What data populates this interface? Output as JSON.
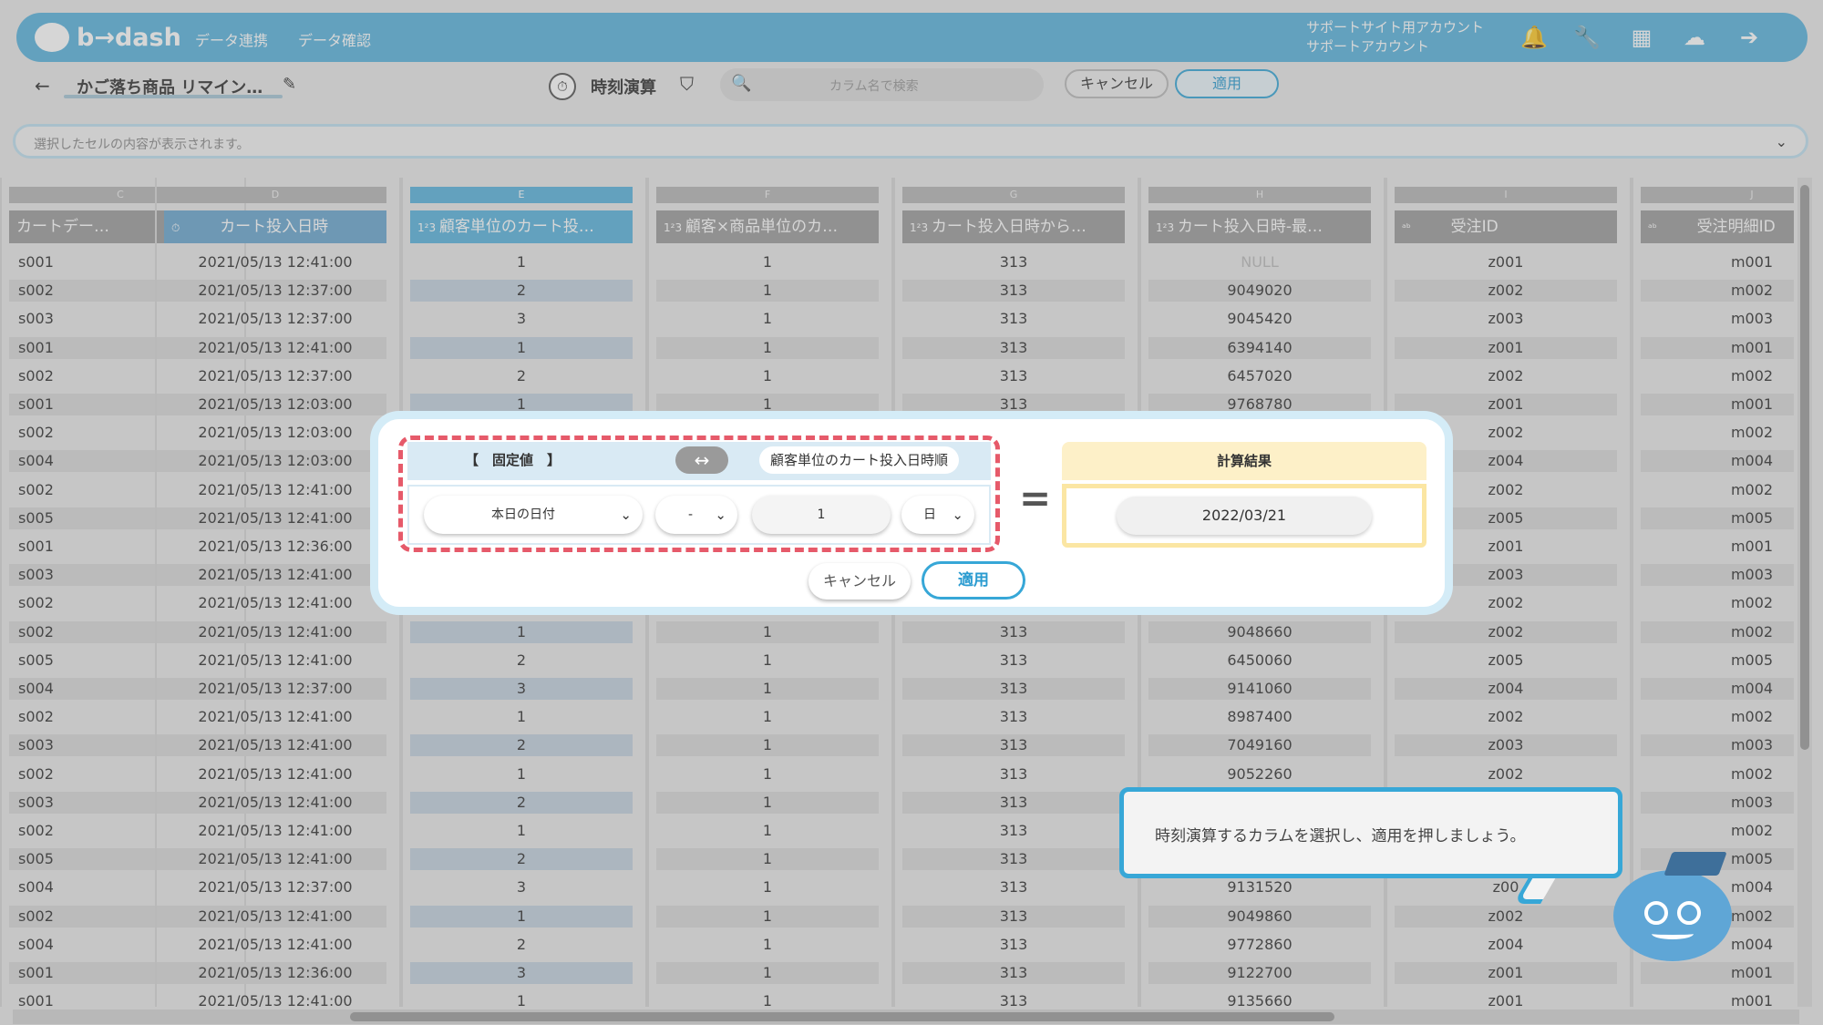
{
  "app": {
    "logo": "b→dash",
    "nav": [
      "データ連携",
      "データ確認"
    ],
    "account_line1": "サポートサイト用アカウント",
    "account_line2": "サポートアカウント"
  },
  "toolbar": {
    "title": "かご落ち商品 リマイン…",
    "function_label": "時刻演算",
    "search_placeholder": "カラム名で検索",
    "cancel": "キャンセル",
    "apply": "適用"
  },
  "cellbar": {
    "placeholder": "選択したセルの内容が表示されます。"
  },
  "columns": [
    {
      "letter": "C",
      "header": "カートデー…",
      "icon": "",
      "kind": "text"
    },
    {
      "letter": "D",
      "header": "カート投入日時",
      "icon": "clock-icon",
      "kind": "date"
    },
    {
      "letter": "E",
      "header": "顧客単位のカート投…",
      "icon": "123-icon",
      "kind": "num",
      "selected": true
    },
    {
      "letter": "F",
      "header": "顧客×商品単位のカ…",
      "icon": "123-icon",
      "kind": "num"
    },
    {
      "letter": "G",
      "header": "カート投入日時から…",
      "icon": "123-icon",
      "kind": "num"
    },
    {
      "letter": "H",
      "header": "カート投入日時-最…",
      "icon": "123-icon",
      "kind": "num"
    },
    {
      "letter": "I",
      "header": "受注ID",
      "icon": "abc-icon",
      "kind": "text"
    },
    {
      "letter": "J",
      "header": "受注明細ID",
      "icon": "abc-icon",
      "kind": "text"
    }
  ],
  "rows": [
    [
      "s001",
      "2021/05/13 12:41:00",
      "1",
      "1",
      "313",
      "NULL",
      "z001",
      "m001"
    ],
    [
      "s002",
      "2021/05/13 12:37:00",
      "2",
      "1",
      "313",
      "9049020",
      "z002",
      "m002"
    ],
    [
      "s003",
      "2021/05/13 12:37:00",
      "3",
      "1",
      "313",
      "9045420",
      "z003",
      "m003"
    ],
    [
      "s001",
      "2021/05/13 12:41:00",
      "1",
      "1",
      "313",
      "6394140",
      "z001",
      "m001"
    ],
    [
      "s002",
      "2021/05/13 12:37:00",
      "2",
      "1",
      "313",
      "6457020",
      "z002",
      "m002"
    ],
    [
      "s001",
      "2021/05/13 12:03:00",
      "1",
      "1",
      "313",
      "9768780",
      "z001",
      "m001"
    ],
    [
      "s002",
      "2021/05/13 12:03:00",
      "",
      "",
      "",
      "",
      "z002",
      "m002"
    ],
    [
      "s004",
      "2021/05/13 12:03:00",
      "",
      "",
      "",
      "",
      "z004",
      "m004"
    ],
    [
      "s002",
      "2021/05/13 12:41:00",
      "",
      "",
      "",
      "",
      "z002",
      "m002"
    ],
    [
      "s005",
      "2021/05/13 12:41:00",
      "",
      "",
      "",
      "",
      "z005",
      "m005"
    ],
    [
      "s001",
      "2021/05/13 12:36:00",
      "",
      "",
      "",
      "",
      "z001",
      "m001"
    ],
    [
      "s003",
      "2021/05/13 12:41:00",
      "",
      "",
      "",
      "",
      "z003",
      "m003"
    ],
    [
      "s002",
      "2021/05/13 12:41:00",
      "",
      "",
      "",
      "",
      "z002",
      "m002"
    ],
    [
      "s002",
      "2021/05/13 12:41:00",
      "1",
      "1",
      "313",
      "9048660",
      "z002",
      "m002"
    ],
    [
      "s005",
      "2021/05/13 12:41:00",
      "2",
      "1",
      "313",
      "6450060",
      "z005",
      "m005"
    ],
    [
      "s004",
      "2021/05/13 12:37:00",
      "3",
      "1",
      "313",
      "9141060",
      "z004",
      "m004"
    ],
    [
      "s002",
      "2021/05/13 12:41:00",
      "1",
      "1",
      "313",
      "8987400",
      "z002",
      "m002"
    ],
    [
      "s003",
      "2021/05/13 12:41:00",
      "2",
      "1",
      "313",
      "7049160",
      "z003",
      "m003"
    ],
    [
      "s002",
      "2021/05/13 12:41:00",
      "1",
      "1",
      "313",
      "9052260",
      "z002",
      "m002"
    ],
    [
      "s003",
      "2021/05/13 12:41:00",
      "2",
      "1",
      "313",
      "",
      "",
      "m003"
    ],
    [
      "s002",
      "2021/05/13 12:41:00",
      "1",
      "1",
      "313",
      "",
      "",
      "m002"
    ],
    [
      "s005",
      "2021/05/13 12:41:00",
      "2",
      "1",
      "313",
      "",
      "",
      "m005"
    ],
    [
      "s004",
      "2021/05/13 12:37:00",
      "3",
      "1",
      "313",
      "9131520",
      "z00",
      "m004"
    ],
    [
      "s002",
      "2021/05/13 12:41:00",
      "1",
      "1",
      "313",
      "9049860",
      "z002",
      "m002"
    ],
    [
      "s004",
      "2021/05/13 12:41:00",
      "2",
      "1",
      "313",
      "9772860",
      "z004",
      "m004"
    ],
    [
      "s001",
      "2021/05/13 12:36:00",
      "3",
      "1",
      "313",
      "9122700",
      "z001",
      "m001"
    ],
    [
      "s001",
      "2021/05/13 12:41:00",
      "1",
      "1",
      "313",
      "9135660",
      "z001",
      "m001"
    ]
  ],
  "dialog": {
    "fixed_label": "【　固定値　】",
    "swap_icon": "swap-arrows-icon",
    "column_ref": "顧客単位のカート投入日時順",
    "base_select": "本日の日付",
    "op_select": "-",
    "amount": "1",
    "unit_select": "日",
    "equals": "=",
    "result_label": "計算結果",
    "result_value": "2022/03/21",
    "cancel": "キャンセル",
    "apply": "適用"
  },
  "tip": {
    "text": "時刻演算するカラムを選択し、適用を押しましょう。"
  },
  "colors": {
    "brand": "#5bb4dd",
    "highlight_dash": "#e65a6a",
    "result_bg": "#fdf0c8"
  }
}
